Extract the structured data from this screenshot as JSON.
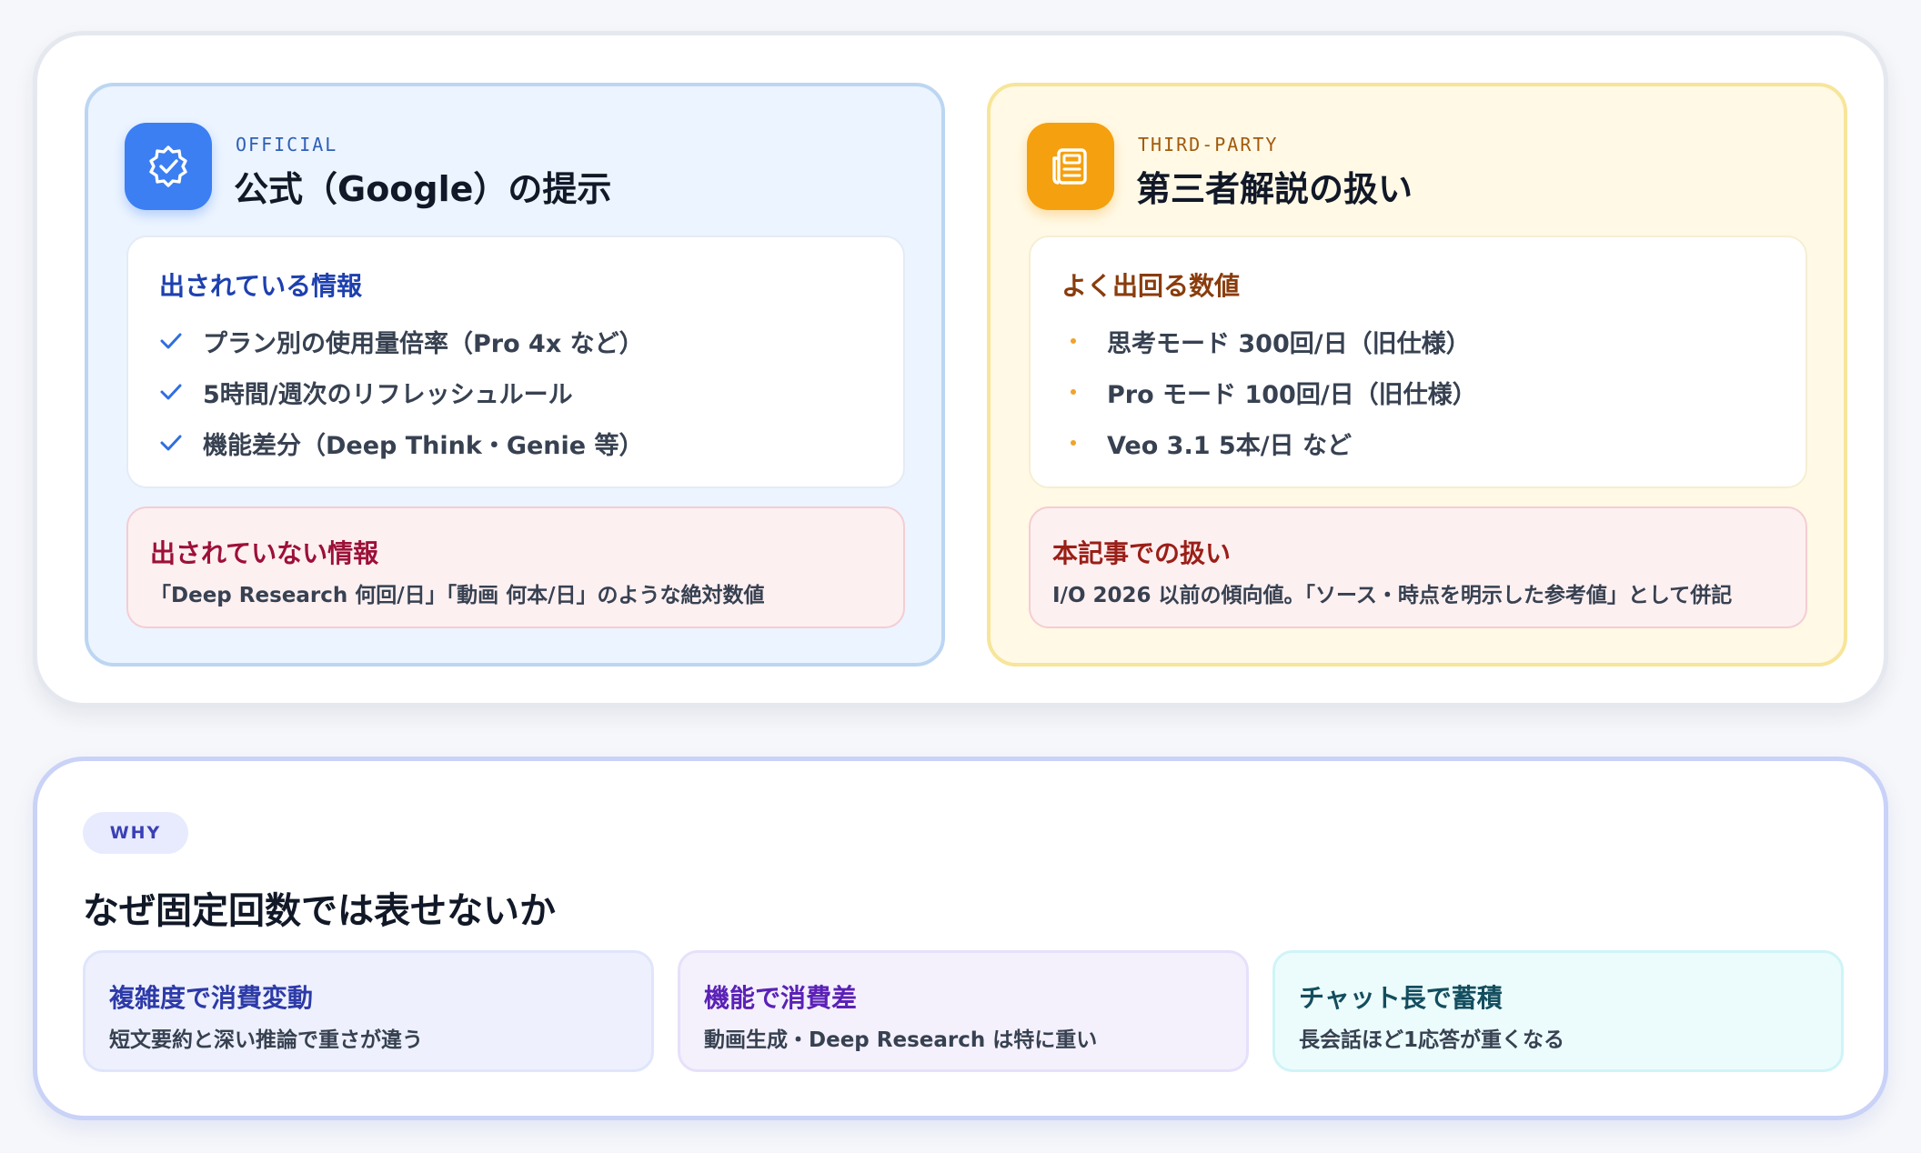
{
  "official": {
    "eyebrow": "OFFICIAL",
    "title": "公式（Google）の提示",
    "icon": "verified-badge-icon",
    "info_heading": "出されている情報",
    "items": [
      "プラン別の使用量倍率（Pro 4x など）",
      "5時間/週次のリフレッシュルール",
      "機能差分（Deep Think・Genie 等）"
    ],
    "note_heading": "出されていない情報",
    "note_text": "「Deep Research 何回/日」「動画 何本/日」のような絶対数値"
  },
  "third_party": {
    "eyebrow": "THIRD-PARTY",
    "title": "第三者解説の扱い",
    "icon": "newspaper-icon",
    "info_heading": "よく出回る数値",
    "items": [
      "思考モード 300回/日（旧仕様）",
      "Pro モード 100回/日（旧仕様）",
      "Veo 3.1 5本/日 など"
    ],
    "note_heading": "本記事での扱い",
    "note_text": "I/O 2026 以前の傾向値。「ソース・時点を明示した参考値」として併記"
  },
  "why": {
    "pill": "WHY",
    "title": "なぜ固定回数では表せないか",
    "reasons": [
      {
        "title": "複雑度で消費変動",
        "desc": "短文要約と深い推論で重さが違う"
      },
      {
        "title": "機能で消費差",
        "desc": "動画生成・Deep Research は特に重い"
      },
      {
        "title": "チャット長で蓄積",
        "desc": "長会話ほど1応答が重くなる"
      }
    ]
  },
  "colors": {
    "official_accent": "#3b7ff2",
    "third_party_accent": "#f5a00f",
    "why_accent": "#3b3fb5"
  }
}
